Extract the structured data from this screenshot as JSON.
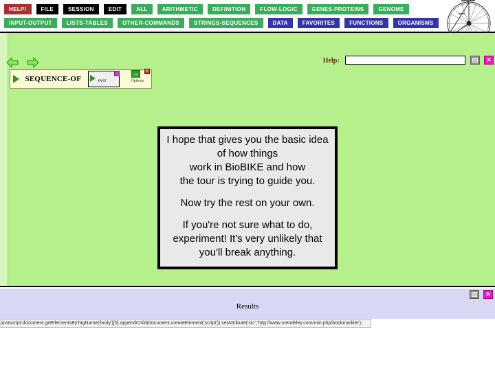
{
  "menu": {
    "row1": [
      {
        "label": "HELP!",
        "style": "help"
      },
      {
        "label": "FILE",
        "style": "dark"
      },
      {
        "label": "SESSION",
        "style": "dark"
      },
      {
        "label": "EDIT",
        "style": "dark"
      },
      {
        "label": "ALL",
        "style": "green"
      },
      {
        "label": "ARITHMETIC",
        "style": "green"
      },
      {
        "label": "DEFINITION",
        "style": "green"
      },
      {
        "label": "FLOW-LOGIC",
        "style": "green"
      },
      {
        "label": "GENES-PROTEINS",
        "style": "green"
      },
      {
        "label": "GENOME",
        "style": "green"
      }
    ],
    "row2": [
      {
        "label": "INPUT-OUTPUT",
        "style": "green"
      },
      {
        "label": "LISTS-TABLES",
        "style": "green"
      },
      {
        "label": "OTHER-COMMANDS",
        "style": "green"
      },
      {
        "label": "STRINGS-SEQUENCES",
        "style": "green"
      },
      {
        "label": "DATA",
        "style": "blue"
      },
      {
        "label": "FAVORITES",
        "style": "blue"
      },
      {
        "label": "FUNCTIONS",
        "style": "blue"
      },
      {
        "label": "ORGANISMS",
        "style": "blue"
      }
    ]
  },
  "toolbar": {
    "back_arrow": "back-arrow",
    "forward_arrow": "forward-arrow"
  },
  "help": {
    "label": "Help:",
    "value": "",
    "placeholder": ""
  },
  "form": {
    "function_name": "SEQUENCE-OF",
    "argument_value": "ever",
    "options_label": "Options",
    "close_label": "x"
  },
  "dialog": {
    "paragraphs": [
      "I hope that gives you the basic idea of how things\nwork in BioBIKE and how\nthe tour is trying to guide you.",
      "Now try the rest on your own.",
      "If you're not sure what to do, experiment! It's very unlikely that you'll break anything."
    ]
  },
  "results": {
    "title": "Results"
  },
  "status": {
    "text": "javascript:document.getElementsByTagName('body')[0].appendChild(document.createElement('script')).setAttribute('src','http://www.mendeley.com/min.php/bookmarklet');"
  },
  "colors": {
    "workspace_green": "#b6f08c",
    "menu_green": "#3aad5c",
    "menu_blue": "#3333aa",
    "menu_help_red": "#a83232",
    "results_lavender": "#d8d8f4",
    "close_magenta": "#f013c0"
  }
}
